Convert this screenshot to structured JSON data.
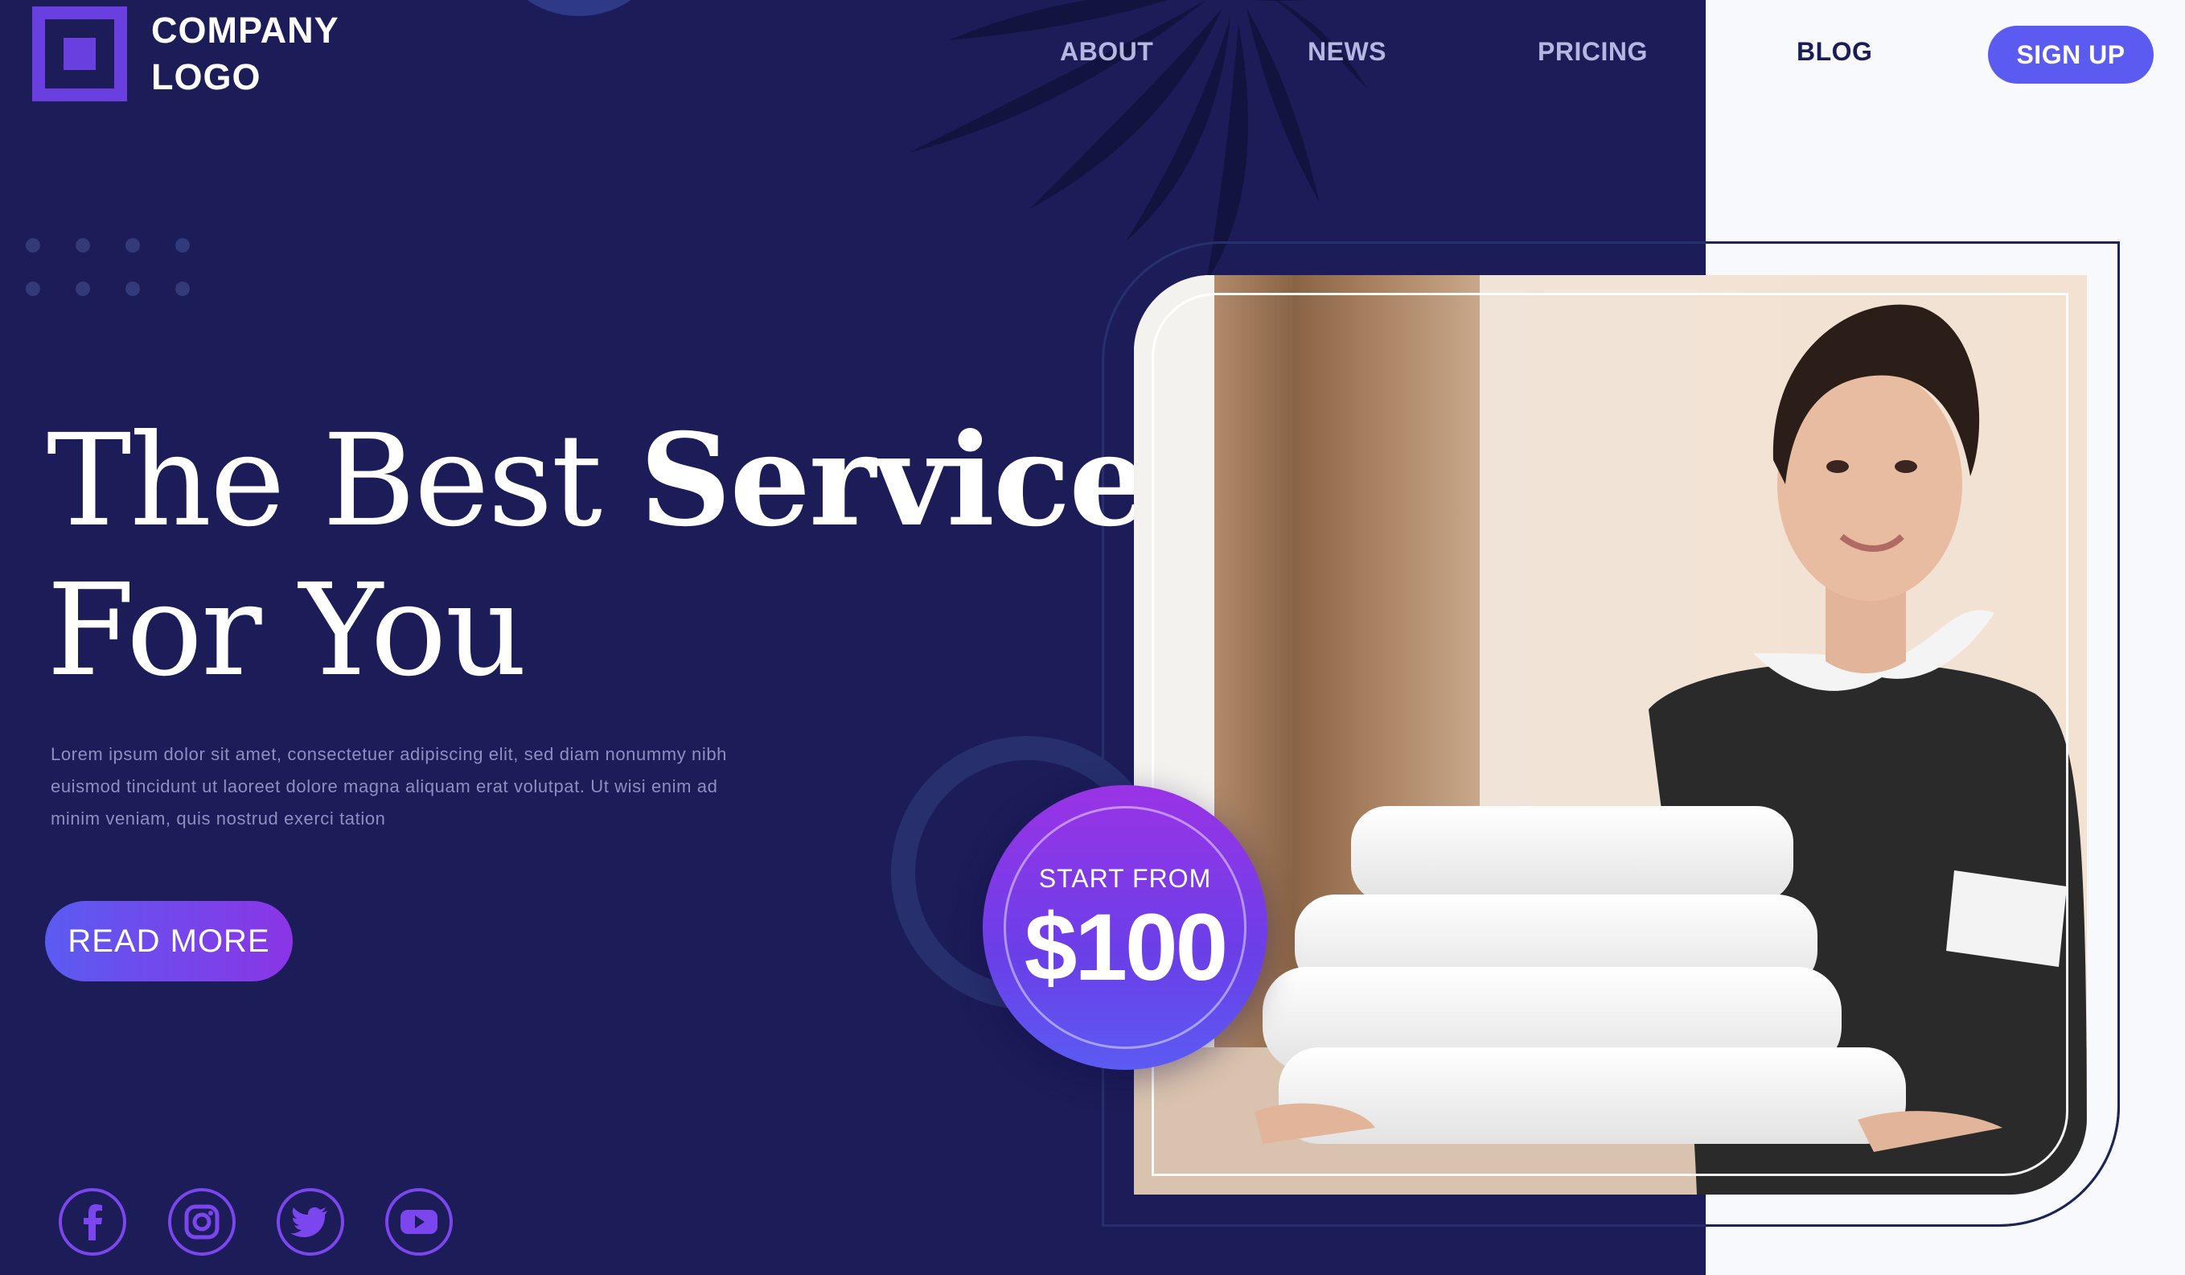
{
  "brand": {
    "logo_line1": "COMPANY",
    "logo_line2": "LOGO"
  },
  "nav": {
    "items": [
      {
        "label": "ABOUT"
      },
      {
        "label": "NEWS"
      },
      {
        "label": "PRICING"
      },
      {
        "label": "BLOG"
      }
    ],
    "signup_label": "SIGN UP"
  },
  "hero": {
    "headline_light": "The Best ",
    "headline_strong": "Service",
    "headline_line2": "For You",
    "body": "Lorem ipsum dolor sit amet, consectetuer adipiscing elit, sed diam nonummy nibh euismod tincidunt ut laoreet dolore magna aliquam erat volutpat. Ut wisi enim ad minim veniam, quis nostrud exerci tation",
    "cta_label": "READ MORE"
  },
  "price_badge": {
    "caption": "START FROM",
    "price": "$100"
  },
  "social": {
    "icons": [
      "facebook-icon",
      "instagram-icon",
      "twitter-icon",
      "youtube-icon"
    ]
  },
  "colors": {
    "background": "#1b1c58",
    "accent": "#5b5bf2",
    "accent_purple": "#8a35e6",
    "light_panel": "#f8f9fc"
  }
}
